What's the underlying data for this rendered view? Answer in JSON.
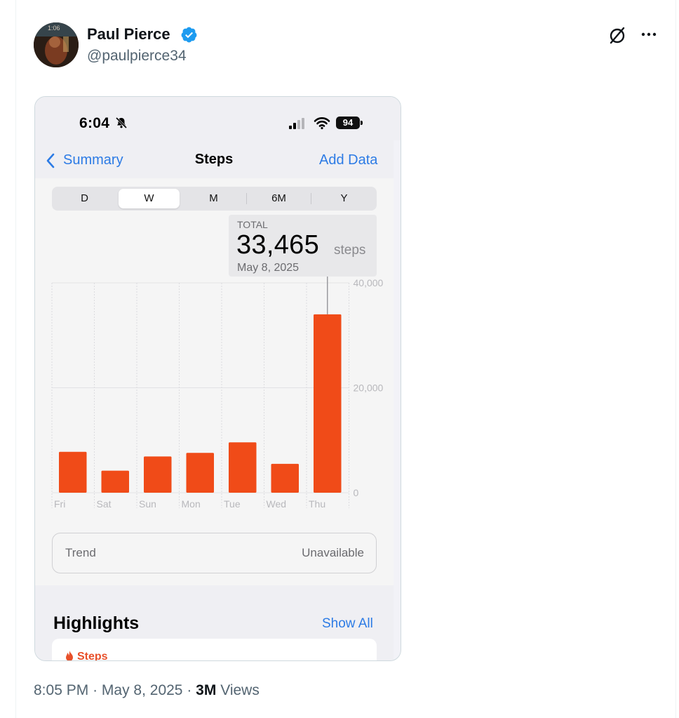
{
  "tweet": {
    "author_name": "Paul Pierce",
    "handle": "@paulpierce34",
    "avatar_overlay_text": "1:06",
    "time": "8:05 PM",
    "separator": "·",
    "date": "May 8, 2025",
    "views_count": "3M",
    "views_label": "Views"
  },
  "phone": {
    "status_time": "6:04",
    "battery": "94",
    "nav": {
      "back_label": "Summary",
      "title": "Steps",
      "action": "Add Data"
    },
    "segments": [
      "D",
      "W",
      "M",
      "6M",
      "Y"
    ],
    "active_segment": "W",
    "callout": {
      "label": "TOTAL",
      "value": "33,465",
      "unit": "steps",
      "date": "May 8, 2025"
    },
    "trend": {
      "label": "Trend",
      "value": "Unavailable"
    },
    "highlights": {
      "title": "Highlights",
      "show_all": "Show All",
      "card_label": "Steps"
    }
  },
  "colors": {
    "accent_blue": "#2c7be5",
    "bar_orange": "#f04b18",
    "verified_blue": "#1d9bf0"
  },
  "icons": [
    "verified-badge-icon",
    "grok-icon",
    "more-icon",
    "silent-bell-icon",
    "cellular-signal-icon",
    "wifi-icon",
    "battery-icon",
    "chevron-left-icon",
    "flame-icon"
  ],
  "chart_data": {
    "type": "bar",
    "categories": [
      "Fri",
      "Sat",
      "Sun",
      "Mon",
      "Tue",
      "Wed",
      "Thu"
    ],
    "values": [
      7800,
      4200,
      6900,
      7600,
      9600,
      5500,
      34000
    ],
    "yticks": [
      "40,000",
      "20,000",
      "0"
    ],
    "ylim": [
      0,
      40000
    ],
    "color": "#f04b18",
    "grid": true,
    "highlighted": "Thu"
  }
}
